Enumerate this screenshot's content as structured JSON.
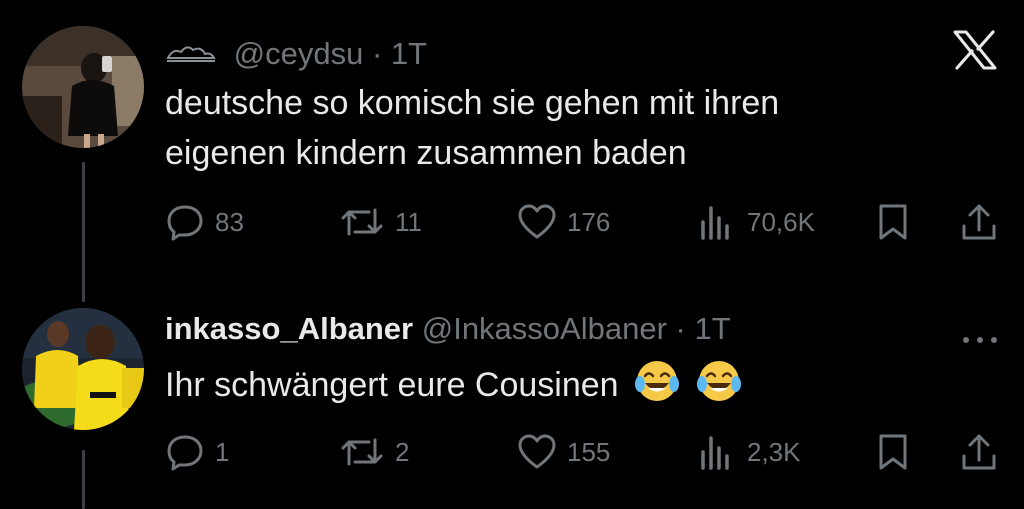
{
  "tweet1": {
    "handle": "@ceydsu",
    "time": "1T",
    "text_line1": "deutsche so komisch sie gehen mit ihren",
    "text_line2": "eigenen kindern zusammen baden",
    "replies": "83",
    "retweets": "11",
    "likes": "176",
    "views": "70,6K"
  },
  "tweet2": {
    "name": "inkasso_Albaner",
    "handle": "@InkassoAlbaner",
    "time": "1T",
    "text": "Ihr schwängert eure Cousinen",
    "replies": "1",
    "retweets": "2",
    "likes": "155",
    "views": "2,3K"
  },
  "separator": "·",
  "icons": {
    "reply": "reply-icon",
    "retweet": "retweet-icon",
    "like": "like-icon",
    "views": "views-icon",
    "bookmark": "bookmark-icon",
    "share": "share-icon",
    "close": "x-logo-icon",
    "more": "more-icon",
    "emoji": "crying-laughing-emoji"
  },
  "colors": {
    "background": "#000000",
    "text": "#e7e9ea",
    "muted": "#71767b",
    "emoji": "#f7c948"
  }
}
